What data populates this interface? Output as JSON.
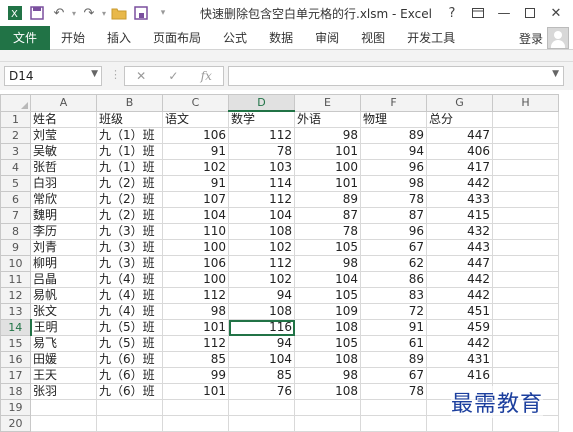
{
  "window": {
    "title": "快速删除包含空白单元格的行.xlsm - Excel",
    "controls": [
      "?",
      "restore-ribbon",
      "minimize",
      "maximize",
      "close"
    ]
  },
  "quick_access": [
    "save-icon",
    "undo-icon",
    "redo-icon",
    "open-folder-icon",
    "save-as-icon"
  ],
  "ribbon": {
    "file_tab": "文件",
    "tabs": [
      "开始",
      "插入",
      "页面布局",
      "公式",
      "数据",
      "审阅",
      "视图",
      "开发工具"
    ],
    "login": "登录"
  },
  "formula_bar": {
    "name_box": "D14",
    "cancel_glyph": "✕",
    "enter_glyph": "✓",
    "fx_glyph": "fx",
    "content": ""
  },
  "sheet": {
    "columns": [
      "A",
      "B",
      "C",
      "D",
      "E",
      "F",
      "G",
      "H"
    ],
    "selected_column": "D",
    "selected_row": 14,
    "active_cell": "D14",
    "rows": [
      [
        "姓名",
        "班级",
        "语文",
        "数学",
        "外语",
        "物理",
        "总分",
        ""
      ],
      [
        "刘莹",
        "九（1）班",
        "106",
        "112",
        "98",
        "89",
        "447",
        ""
      ],
      [
        "吴敏",
        "九（1）班",
        "91",
        "78",
        "101",
        "94",
        "406",
        ""
      ],
      [
        "张哲",
        "九（1）班",
        "102",
        "103",
        "100",
        "96",
        "417",
        ""
      ],
      [
        "白羽",
        "九（2）班",
        "91",
        "114",
        "101",
        "98",
        "442",
        ""
      ],
      [
        "常欣",
        "九（2）班",
        "107",
        "112",
        "89",
        "78",
        "433",
        ""
      ],
      [
        "魏明",
        "九（2）班",
        "104",
        "104",
        "87",
        "87",
        "415",
        ""
      ],
      [
        "李历",
        "九（3）班",
        "110",
        "108",
        "78",
        "96",
        "432",
        ""
      ],
      [
        "刘青",
        "九（3）班",
        "100",
        "102",
        "105",
        "67",
        "443",
        ""
      ],
      [
        "柳明",
        "九（3）班",
        "106",
        "112",
        "98",
        "62",
        "447",
        ""
      ],
      [
        "吕晶",
        "九（4）班",
        "100",
        "102",
        "104",
        "86",
        "442",
        ""
      ],
      [
        "易帆",
        "九（4）班",
        "112",
        "94",
        "105",
        "83",
        "442",
        ""
      ],
      [
        "张文",
        "九（4）班",
        "98",
        "108",
        "109",
        "72",
        "451",
        ""
      ],
      [
        "王明",
        "九（5）班",
        "101",
        "116",
        "108",
        "91",
        "459",
        ""
      ],
      [
        "易飞",
        "九（5）班",
        "112",
        "94",
        "105",
        "61",
        "442",
        ""
      ],
      [
        "田媛",
        "九（6）班",
        "85",
        "104",
        "108",
        "89",
        "431",
        ""
      ],
      [
        "王天",
        "九（6）班",
        "99",
        "85",
        "98",
        "67",
        "416",
        ""
      ],
      [
        "张羽",
        "九（6）班",
        "101",
        "76",
        "108",
        "78",
        "",
        ""
      ],
      [
        "",
        "",
        "",
        "",
        "",
        "",
        "",
        ""
      ],
      [
        "",
        "",
        "",
        "",
        "",
        "",
        "",
        ""
      ]
    ]
  },
  "watermark": "最需教育",
  "colors": {
    "excel_green": "#217346",
    "watermark_blue": "#1c3f9e",
    "header_gray": "#f3f3f3"
  }
}
